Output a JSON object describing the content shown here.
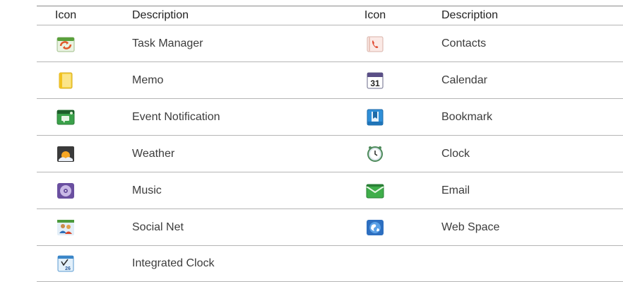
{
  "header": {
    "icon_col_1": "Icon",
    "desc_col_1": "Description",
    "icon_col_2": "Icon",
    "desc_col_2": "Description"
  },
  "rows": [
    {
      "left": {
        "icon": "task-manager-icon",
        "label": "Task Manager"
      },
      "right": {
        "icon": "contacts-icon",
        "label": "Contacts"
      }
    },
    {
      "left": {
        "icon": "memo-icon",
        "label": "Memo"
      },
      "right": {
        "icon": "calendar-icon",
        "label": "Calendar",
        "icon_text": "31"
      }
    },
    {
      "left": {
        "icon": "event-notification-icon",
        "label": "Event Notification"
      },
      "right": {
        "icon": "bookmark-icon",
        "label": "Bookmark"
      }
    },
    {
      "left": {
        "icon": "weather-icon",
        "label": "Weather"
      },
      "right": {
        "icon": "clock-icon",
        "label": "Clock"
      }
    },
    {
      "left": {
        "icon": "music-icon",
        "label": "Music"
      },
      "right": {
        "icon": "email-icon",
        "label": "Email"
      }
    },
    {
      "left": {
        "icon": "social-net-icon",
        "label": "Social Net"
      },
      "right": {
        "icon": "web-space-icon",
        "label": "Web Space"
      }
    },
    {
      "left": {
        "icon": "integrated-clock-icon",
        "label": "Integrated Clock",
        "icon_text": "26"
      },
      "right": null
    }
  ]
}
